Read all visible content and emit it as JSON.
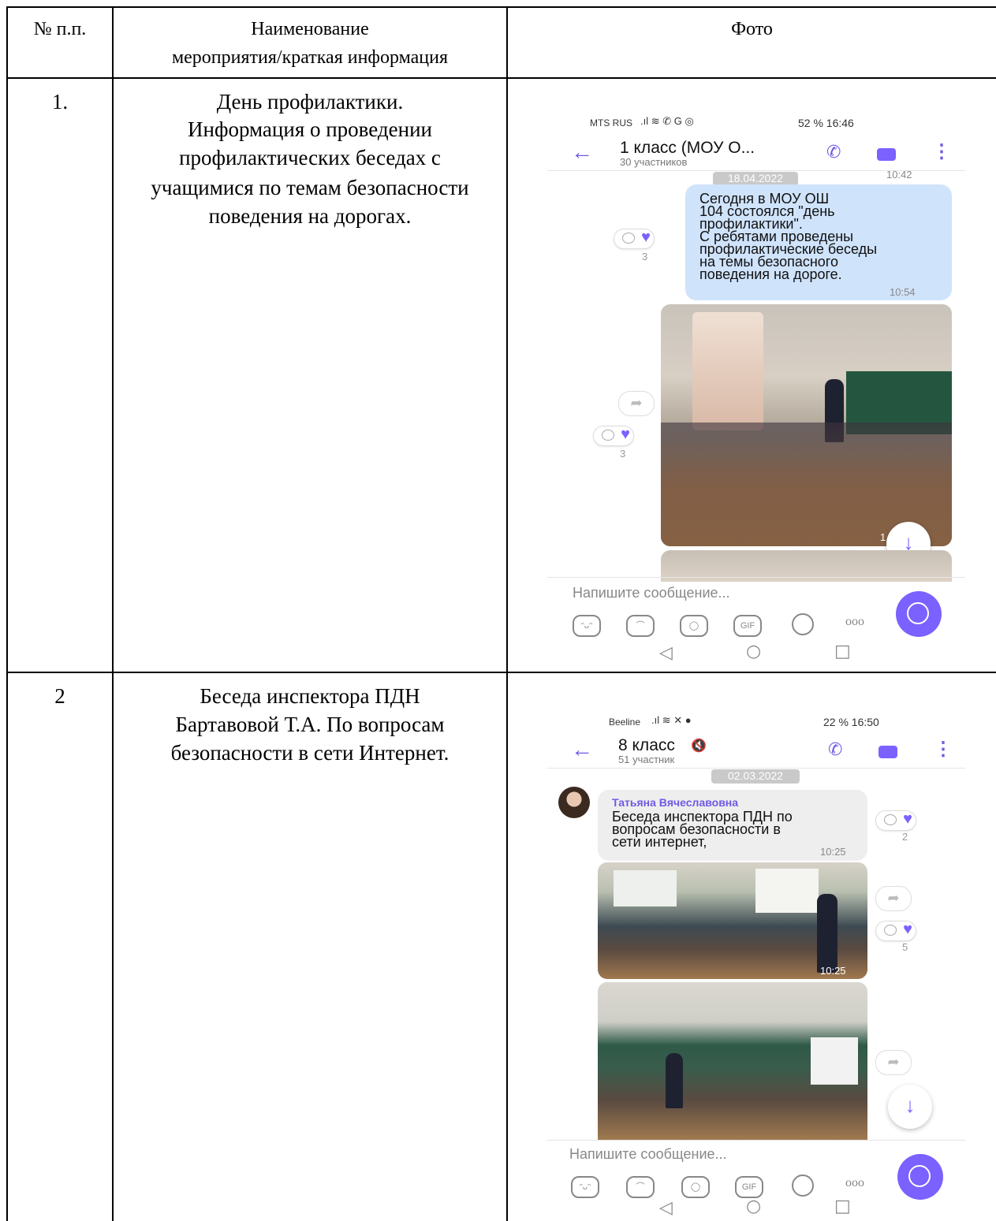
{
  "header": {
    "col1": "№ п.п.",
    "col2_line1": "Наименование",
    "col2_line2": "мероприятия/краткая информация",
    "col3": "Фото"
  },
  "rows": [
    {
      "num": "1.",
      "text_lines": [
        "День профилактики.",
        "Информация о проведении",
        "профилактических беседах  с",
        "учащимися по темам безопасности",
        "поведения на дорогах."
      ],
      "phone": {
        "status_left": "MTS RUS",
        "status_right": "52 %  16:46",
        "chat_title": "1 класс  (МОУ О...",
        "chat_sub": "30 участников",
        "date": "18.04.2022",
        "prev_time": "10:42",
        "message": [
          "Сегодня в МОУ ОШ",
          "104 состоялся \"день",
          "профилактики\".",
          "С ребятами проведены",
          "профилактические беседы",
          "на темы безопасного",
          "поведения на дороге."
        ],
        "message_time": "10:54",
        "msg_reactions": "3",
        "photo_reactions": "3",
        "photo_time": "1",
        "input_placeholder": "Напишите сообщение...",
        "gif_label": "GIF"
      }
    },
    {
      "num": "2",
      "text_lines": [
        "Беседа инспектора ПДН",
        "Бартавовой Т.А. По вопросам",
        "безопасности в сети Интернет."
      ],
      "phone": {
        "status_left": "Beeline",
        "status_right": "22 %  16:50",
        "chat_title": "8 класс",
        "chat_sub": "51 участник",
        "date": "02.03.2022",
        "sender": "Татьяна Вячеславовна",
        "message": [
          "Беседа инспектора ПДН по",
          "вопросам безопасности в",
          "сети интернет,"
        ],
        "message_time": "10:25",
        "msg_reactions": "2",
        "photo1_time": "10:25",
        "photo1_reactions": "5",
        "input_placeholder": "Напишите сообщение...",
        "gif_label": "GIF"
      }
    }
  ],
  "colors": {
    "bubble_blue": "#cfe3fb",
    "bubble_gray": "#eeeeee",
    "accent": "#7b61ff"
  }
}
